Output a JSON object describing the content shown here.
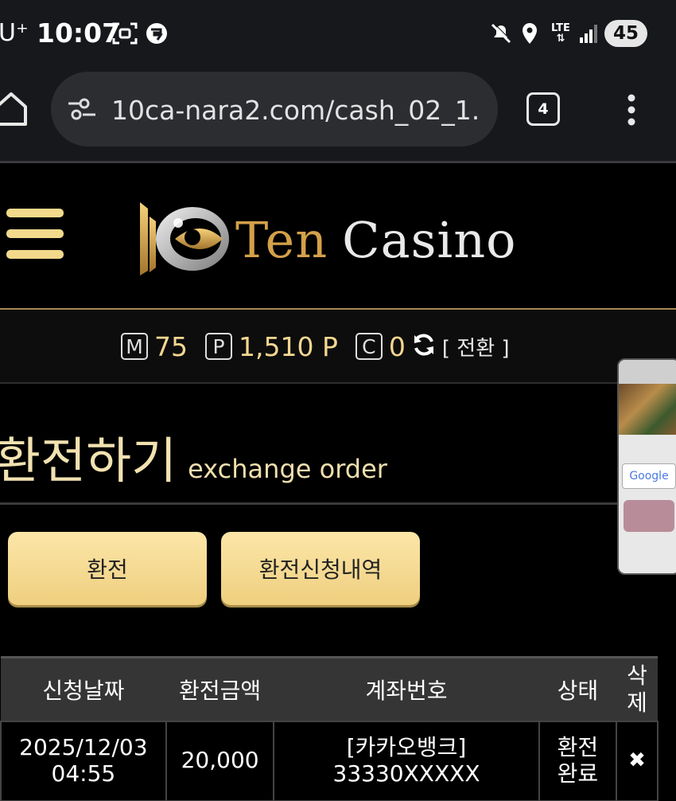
{
  "status_bar": {
    "carrier": "U⁺",
    "time": "10:07",
    "network": "LTE",
    "battery": "45",
    "icons": [
      "screenshot-icon",
      "app-notification-icon",
      "mute-icon",
      "location-icon",
      "lte-icon",
      "signal-icon"
    ]
  },
  "browser": {
    "url": "10ca-nara2.com/cash_02_1.",
    "tab_count": "4",
    "icons": [
      "home-icon",
      "site-settings-icon",
      "more-menu-icon"
    ]
  },
  "site": {
    "logo_ten": "Ten",
    "logo_casino": "Casino",
    "colors": {
      "gold": "#f4d790",
      "button": "#f5d98d",
      "account_link": "#5a78c8"
    }
  },
  "balance": {
    "m_label": "M",
    "m_value": "75",
    "p_label": "P",
    "p_value": "1,510 P",
    "c_label": "C",
    "c_value": "0",
    "convert_label": "[ 전환 ]"
  },
  "page": {
    "title_ko": "환전하기",
    "title_en": "exchange order",
    "buttons": {
      "exchange": "환전",
      "history": "환전신청내역"
    }
  },
  "table": {
    "headers": {
      "date": "신청날짜",
      "amount": "환전금액",
      "account": "계좌번호",
      "status": "상태",
      "delete_1": "삭",
      "delete_2": "제"
    },
    "rows": [
      {
        "date": "2025/12/03",
        "time": "04:55",
        "amount": "20,000",
        "bank": "[카카오뱅크]",
        "account": "33330XXXXX",
        "status_1": "환전",
        "status_2": "완료",
        "delete": "✖"
      }
    ]
  }
}
